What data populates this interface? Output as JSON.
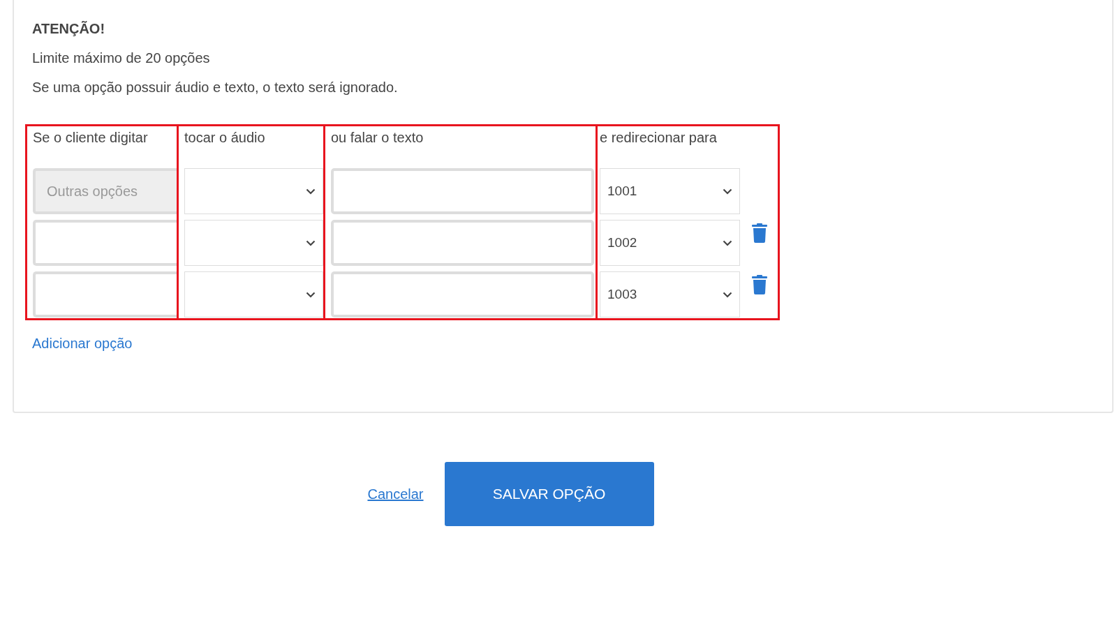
{
  "notice": {
    "title": "ATENÇÃO!",
    "lines": [
      "Limite máximo de 20 opções",
      "Se uma opção possuir áudio e texto, o texto será ignorado."
    ]
  },
  "columns": [
    "Se o cliente digitar",
    "tocar o áudio",
    "ou falar o texto",
    "e redirecionar para"
  ],
  "rows": [
    {
      "key": "Outras opções",
      "disabled": true,
      "redirect": "1001",
      "deletable": false
    },
    {
      "key": "",
      "disabled": false,
      "redirect": "1002",
      "deletable": true
    },
    {
      "key": "",
      "disabled": false,
      "redirect": "1003",
      "deletable": true
    }
  ],
  "add_link": "Adicionar opção",
  "cancel": "Cancelar",
  "save": "SALVAR OPÇÃO"
}
